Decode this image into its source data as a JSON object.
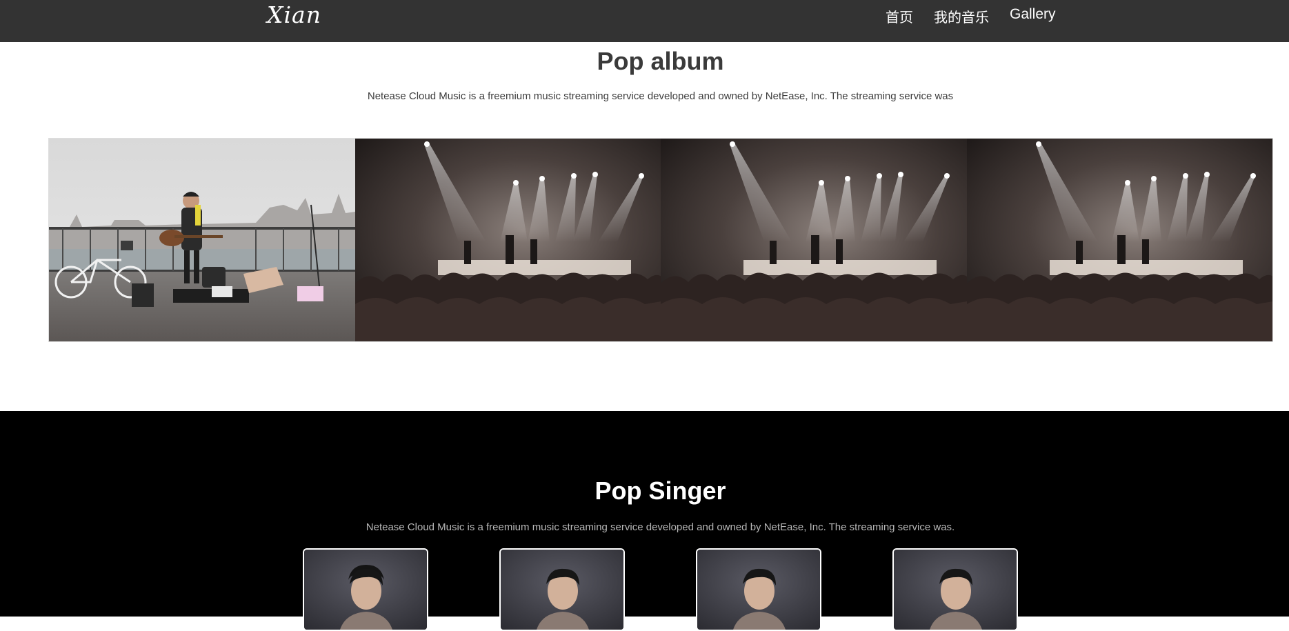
{
  "header": {
    "logo_text": "Xian",
    "nav": [
      {
        "label": "首页"
      },
      {
        "label": "我的音乐"
      },
      {
        "label": "Gallery"
      }
    ]
  },
  "album": {
    "title": "Pop album",
    "description": "Netease Cloud Music is a freemium music streaming service developed and owned by NetEase, Inc. The streaming service was"
  },
  "gallery": {
    "panels": [
      "street-musician-photo",
      "concert-stage-photo",
      "concert-stage-photo",
      "concert-stage-photo"
    ]
  },
  "singer": {
    "title": "Pop Singer",
    "description": "Netease Cloud Music is a freemium music streaming service developed and owned by NetEase, Inc. The streaming service was.",
    "cards": [
      "singer-portrait",
      "singer-portrait",
      "singer-portrait",
      "singer-portrait"
    ]
  },
  "colors": {
    "header_bg": "#333333",
    "singer_bg": "#000000",
    "card_border": "#ffffff"
  }
}
